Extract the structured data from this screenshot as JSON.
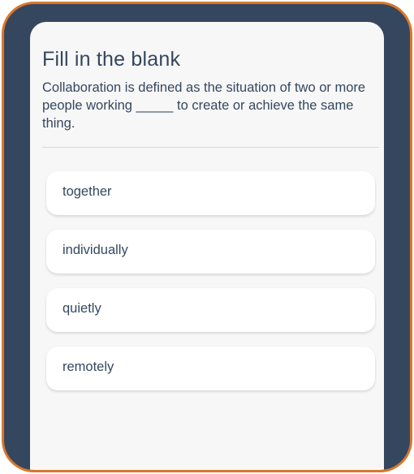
{
  "question": {
    "title": "Fill in the blank",
    "prompt": "Collaboration is defined as the situation of two or more people working _____ to create or achieve the same thing."
  },
  "options": [
    {
      "label": "together"
    },
    {
      "label": "individually"
    },
    {
      "label": "quietly"
    },
    {
      "label": "remotely"
    }
  ],
  "colors": {
    "frame_border": "#d9772a",
    "frame_background": "#35475f",
    "card_background": "#f7f7f7",
    "text": "#35475f",
    "option_background": "#ffffff"
  }
}
